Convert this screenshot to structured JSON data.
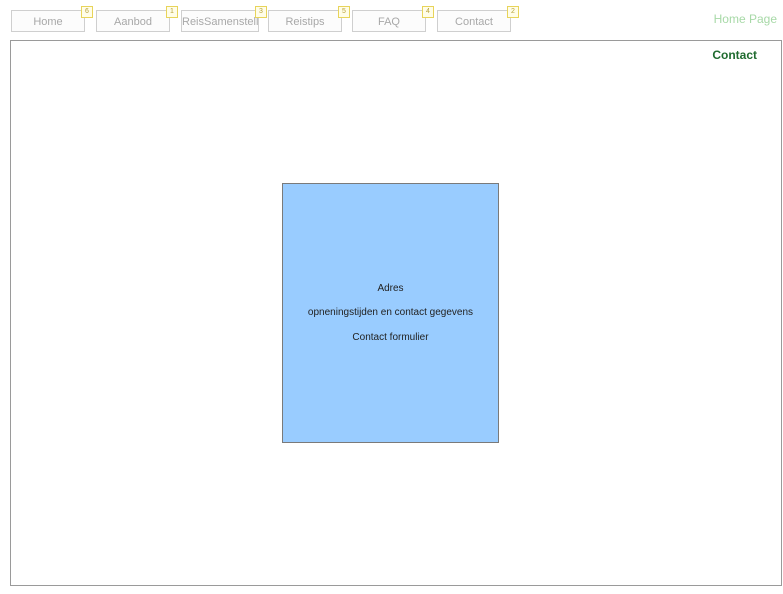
{
  "nav": {
    "tabs": [
      {
        "label": "Home",
        "badge": "6"
      },
      {
        "label": "Aanbod",
        "badge": "1"
      },
      {
        "label": "ReisSamenstelle",
        "badge": "3"
      },
      {
        "label": "Reistips",
        "badge": "5"
      },
      {
        "label": "FAQ",
        "badge": "4"
      },
      {
        "label": "Contact",
        "badge": "2"
      }
    ],
    "home_page_label": "Home Page"
  },
  "page": {
    "title": "Contact"
  },
  "info_box": {
    "lines": [
      "Adres",
      "opneningstijden en contact gegevens",
      "Contact formulier"
    ]
  }
}
